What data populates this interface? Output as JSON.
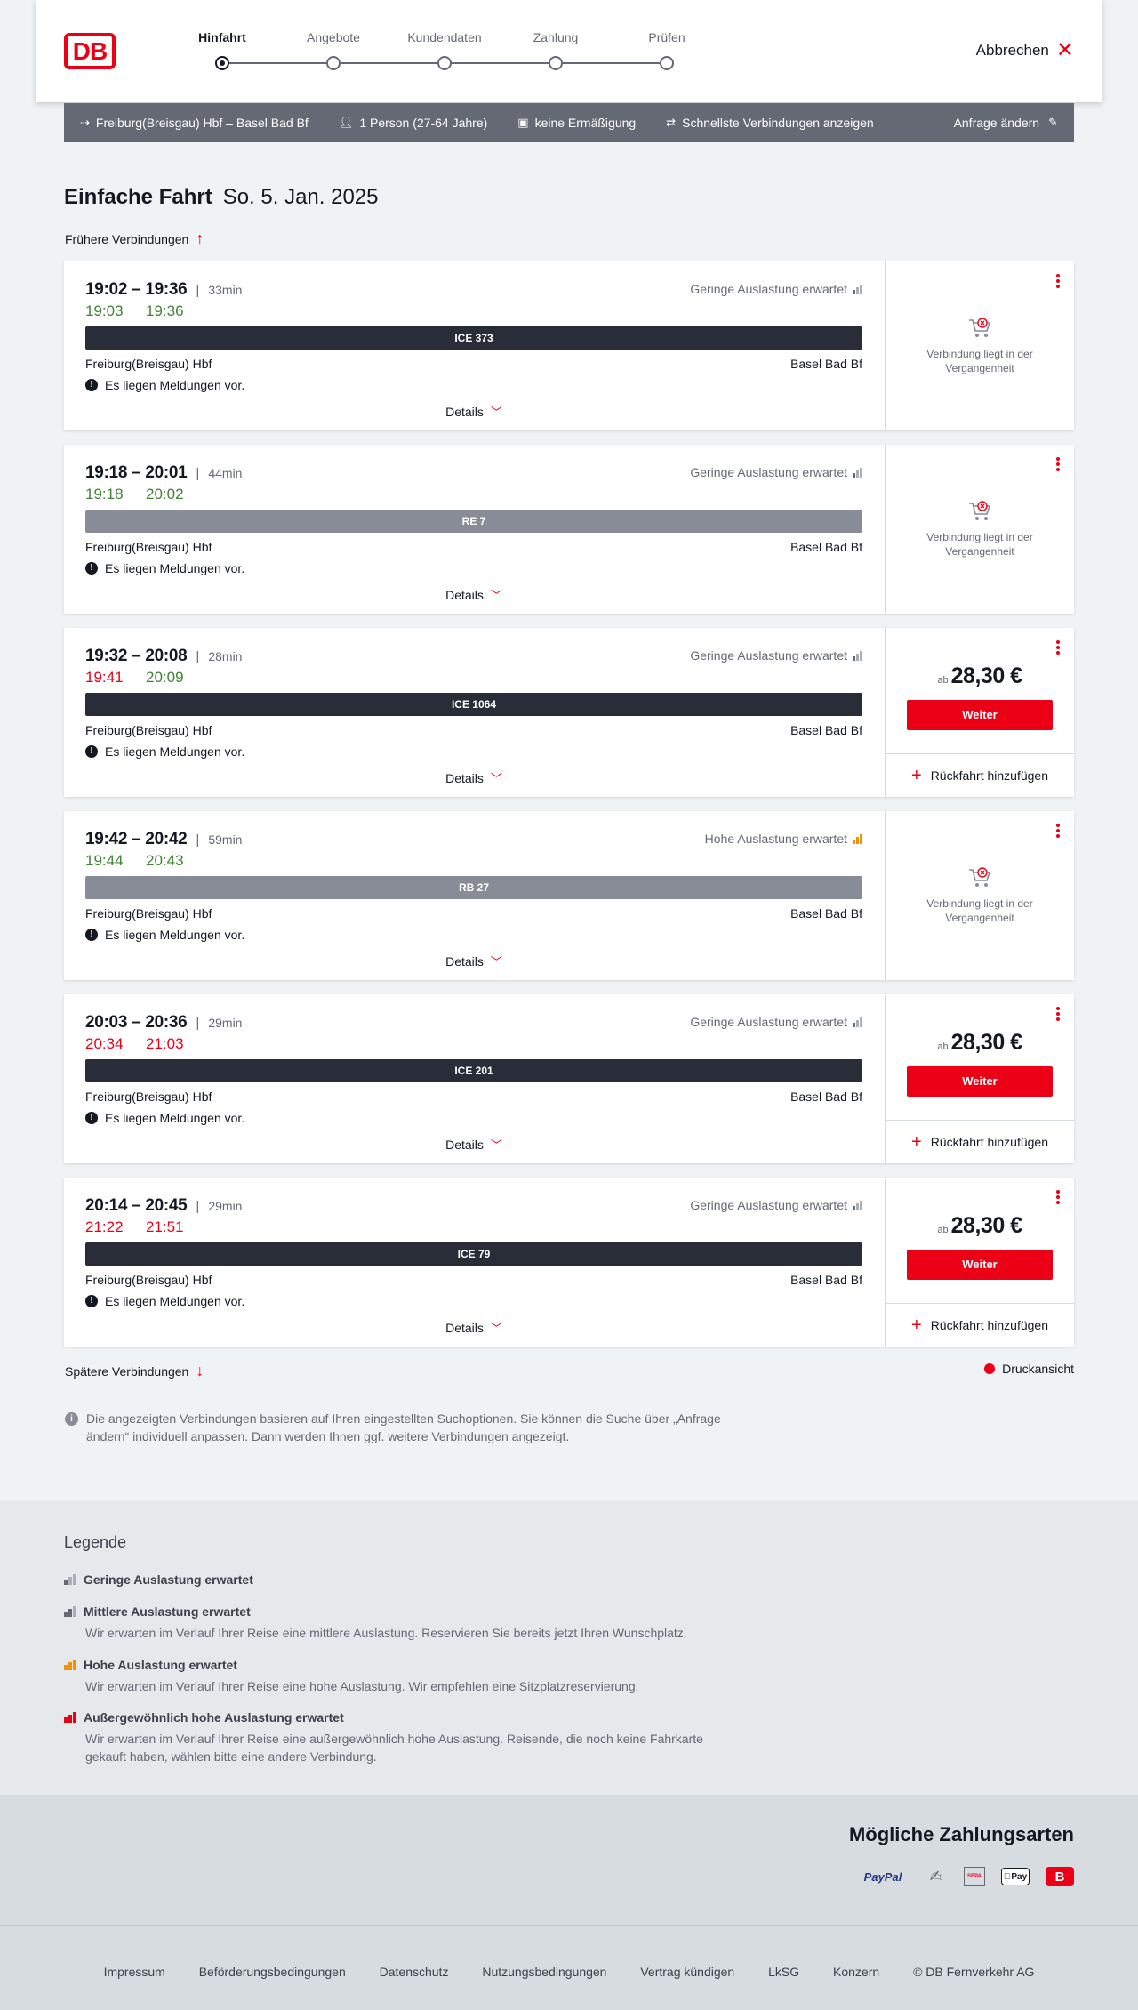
{
  "header": {
    "logo": "DB",
    "steps": [
      "Hinfahrt",
      "Angebote",
      "Kundendaten",
      "Zahlung",
      "Prüfen"
    ],
    "active_step": 0,
    "cancel_label": "Abbrechen"
  },
  "query": {
    "route": "Freiburg(Breisgau) Hbf – Basel Bad Bf",
    "passengers": "1 Person (27-64 Jahre)",
    "discount": "keine Ermäßigung",
    "option": "Schnellste Verbindungen anzeigen",
    "change_label": "Anfrage ändern"
  },
  "title": {
    "main": "Einfache Fahrt",
    "date": "So. 5. Jan. 2025"
  },
  "earlier_label": "Frühere Verbindungen",
  "later_label": "Spätere Verbindungen",
  "print_label": "Druckansicht",
  "details_label": "Details",
  "from_station": "Freiburg(Breisgau) Hbf",
  "to_station": "Basel Bad Bf",
  "notice": "Es liegen Meldungen vor.",
  "past_text": "Verbindung liegt in der Vergangenheit",
  "price_prefix": "ab",
  "continue_label": "Weiter",
  "return_label": "Rückfahrt hinzufügen",
  "connections": [
    {
      "times": "19:02 – 19:36",
      "duration": "33min",
      "rt_dep": "19:03",
      "rt_arr": "19:36",
      "dep_status": "on",
      "arr_status": "on",
      "train": "ICE 373",
      "train_style": "dark",
      "occupancy": "Geringe Auslastung erwartet",
      "occ_level": "low",
      "bookable": false,
      "price": ""
    },
    {
      "times": "19:18 – 20:01",
      "duration": "44min",
      "rt_dep": "19:18",
      "rt_arr": "20:02",
      "dep_status": "on",
      "arr_status": "on",
      "train": "RE 7",
      "train_style": "grey",
      "occupancy": "Geringe Auslastung erwartet",
      "occ_level": "low",
      "bookable": false,
      "price": ""
    },
    {
      "times": "19:32 – 20:08",
      "duration": "28min",
      "rt_dep": "19:41",
      "rt_arr": "20:09",
      "dep_status": "late",
      "arr_status": "on",
      "train": "ICE 1064",
      "train_style": "dark",
      "occupancy": "Geringe Auslastung erwartet",
      "occ_level": "low",
      "bookable": true,
      "price": "28,30 €"
    },
    {
      "times": "19:42 – 20:42",
      "duration": "59min",
      "rt_dep": "19:44",
      "rt_arr": "20:43",
      "dep_status": "on",
      "arr_status": "on",
      "train": "RB 27",
      "train_style": "grey",
      "occupancy": "Hohe Auslastung erwartet",
      "occ_level": "high",
      "bookable": false,
      "price": ""
    },
    {
      "times": "20:03 – 20:36",
      "duration": "29min",
      "rt_dep": "20:34",
      "rt_arr": "21:03",
      "dep_status": "late",
      "arr_status": "late",
      "train": "ICE 201",
      "train_style": "dark",
      "occupancy": "Geringe Auslastung erwartet",
      "occ_level": "low",
      "bookable": true,
      "price": "28,30 €"
    },
    {
      "times": "20:14 – 20:45",
      "duration": "29min",
      "rt_dep": "21:22",
      "rt_arr": "21:51",
      "dep_status": "late",
      "arr_status": "late",
      "train": "ICE 79",
      "train_style": "dark",
      "occupancy": "Geringe Auslastung erwartet",
      "occ_level": "low",
      "bookable": true,
      "price": "28,30 €"
    }
  ],
  "info_text": "Die angezeigten Verbindungen basieren auf Ihren eingestellten Suchoptionen. Sie können die Suche über „Anfrage ändern“ individuell anpassen. Dann werden Ihnen ggf. weitere Verbindungen angezeigt.",
  "legend": {
    "title": "Legende",
    "items": [
      {
        "title": "Geringe Auslastung erwartet",
        "desc": "",
        "level": "low"
      },
      {
        "title": "Mittlere Auslastung erwartet",
        "desc": "Wir erwarten im Verlauf Ihrer Reise eine mittlere Auslastung. Reservieren Sie bereits jetzt Ihren Wunschplatz.",
        "level": "mid"
      },
      {
        "title": "Hohe Auslastung erwartet",
        "desc": "Wir erwarten im Verlauf Ihrer Reise eine hohe Auslastung. Wir empfehlen eine Sitzplatzreservierung.",
        "level": "high"
      },
      {
        "title": "Außergewöhnlich hohe Auslastung erwartet",
        "desc": "Wir erwarten im Verlauf Ihrer Reise eine außergewöhnlich hohe Auslastung. Reisende, die noch keine Fahrkarte gekauft haben, wählen bitte eine andere Verbindung.",
        "level": "xhigh"
      }
    ]
  },
  "payment": {
    "title": "Mögliche Zahlungsarten",
    "methods": [
      {
        "name": "paypal-icon",
        "text": "PayPal"
      },
      {
        "name": "credit-card-icon",
        "text": ""
      },
      {
        "name": "sepa-icon",
        "text": "SEPA"
      },
      {
        "name": "apple-pay-icon",
        "text": "Pay"
      },
      {
        "name": "db-bahn-bonus-icon",
        "text": "B"
      }
    ]
  },
  "footer": {
    "links": [
      "Impressum",
      "Beförderungsbedingungen",
      "Datenschutz",
      "Nutzungsbedingungen",
      "Vertrag kündigen",
      "LkSG",
      "Konzern",
      "© DB Fernverkehr AG"
    ]
  },
  "colors": {
    "accent": "#ec0016",
    "on_time": "#408335",
    "delay": "#ec0016",
    "train_dark": "#282d37",
    "train_grey": "#878c96",
    "occupancy_high": "#f39200"
  }
}
